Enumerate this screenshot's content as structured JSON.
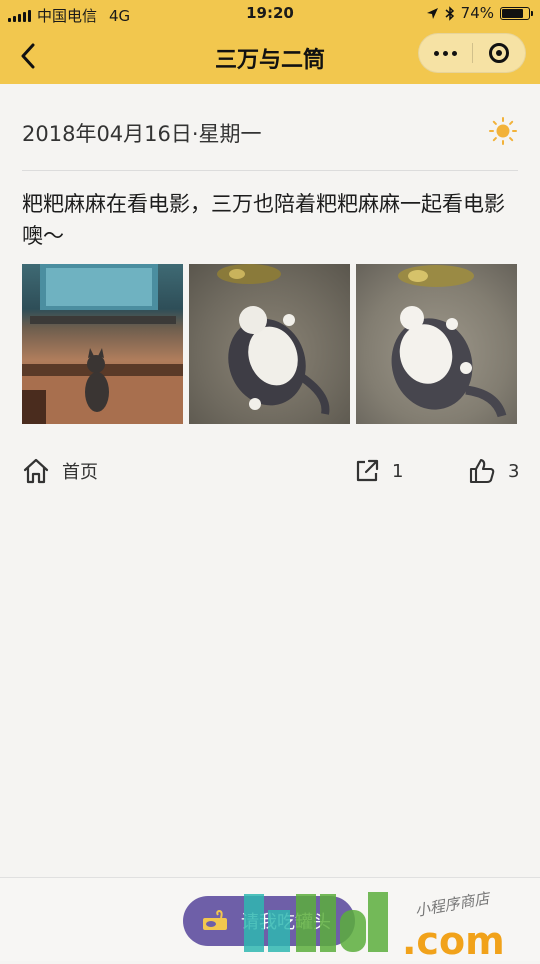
{
  "status_bar": {
    "carrier": "中国电信",
    "network": "4G",
    "time": "19:20",
    "battery": "74%",
    "battery_level": 0.74
  },
  "nav": {
    "title": "三万与二筒"
  },
  "post": {
    "date": "2018年04月16日·星期一",
    "weather_icon": "sun-icon",
    "text": "粑粑麻麻在看电影，三万也陪着粑粑麻麻一起看电影噢～",
    "photos": [
      {
        "description_icon": "photo-cat-watching-tv"
      },
      {
        "description_icon": "photo-cat-with-fish-toy"
      },
      {
        "description_icon": "photo-cat-with-fish-toy"
      }
    ]
  },
  "actions": {
    "home_label": "首页",
    "share_count": "1",
    "like_count": "3"
  },
  "bottom": {
    "treat_label": "请我吃罐头"
  },
  "watermark": {
    "text_main": ".com",
    "text_sub": "小程序商店"
  },
  "colors": {
    "header": "#f2c74e",
    "button": "#6e5fa8",
    "sun": "#f2b23a"
  }
}
